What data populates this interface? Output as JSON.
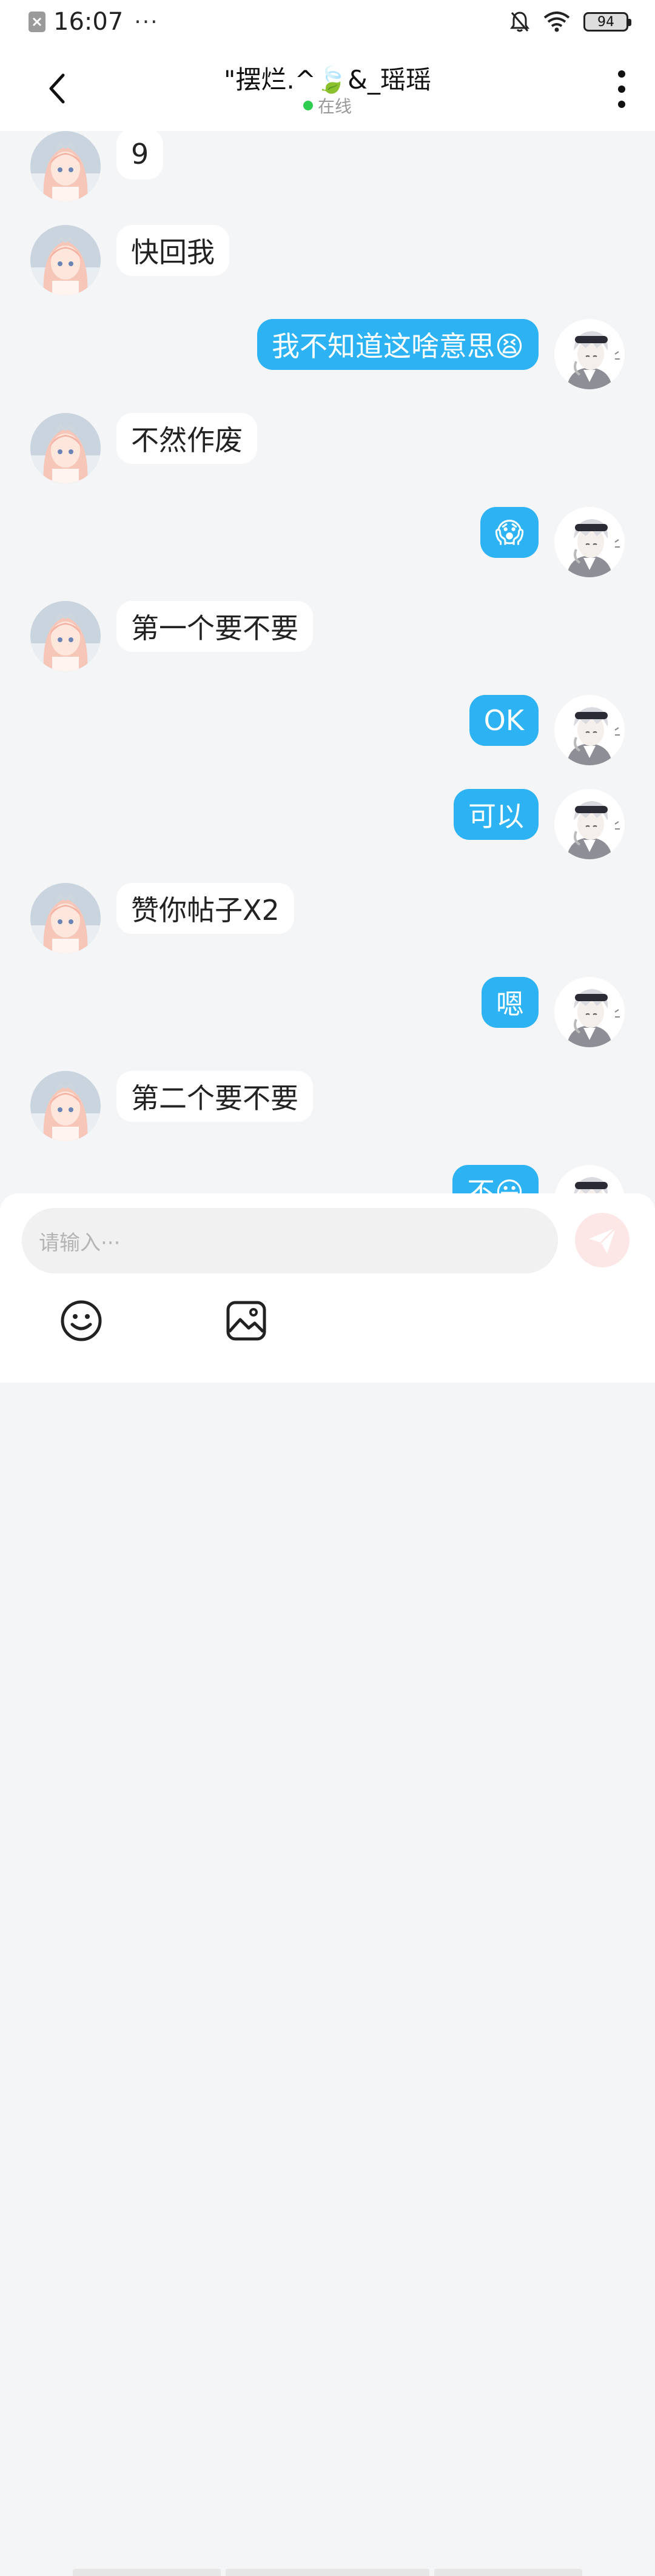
{
  "status_bar": {
    "time": "16:07",
    "more": "···",
    "battery": "94",
    "icons": [
      "app-notification-icon",
      "bell-muted-icon",
      "wifi-icon",
      "battery-icon"
    ]
  },
  "header": {
    "title": "\"摆烂.^🍃&_瑶瑶",
    "status": "在线",
    "status_color": "#2ecc51"
  },
  "messages": [
    {
      "sender": "her",
      "text": "9"
    },
    {
      "sender": "her",
      "text": "快回我"
    },
    {
      "sender": "me",
      "text": "我不知道这啥意思😫"
    },
    {
      "sender": "her",
      "text": "不然作废"
    },
    {
      "sender": "me",
      "text": "😱"
    },
    {
      "sender": "her",
      "text": "第一个要不要"
    },
    {
      "sender": "me",
      "text": "OK"
    },
    {
      "sender": "me",
      "text": "可以"
    },
    {
      "sender": "her",
      "text": "赞你帖子X2"
    },
    {
      "sender": "me",
      "text": "嗯"
    },
    {
      "sender": "her",
      "text": "第二个要不要"
    },
    {
      "sender": "me",
      "text": "不😃"
    }
  ],
  "input": {
    "placeholder": "请输入···"
  },
  "toolbar": {
    "icons": [
      "emoji-icon",
      "image-icon"
    ]
  },
  "colors": {
    "accent": "#2db3f3",
    "background": "#f4f5f7",
    "send_button": "#fde7e6"
  }
}
